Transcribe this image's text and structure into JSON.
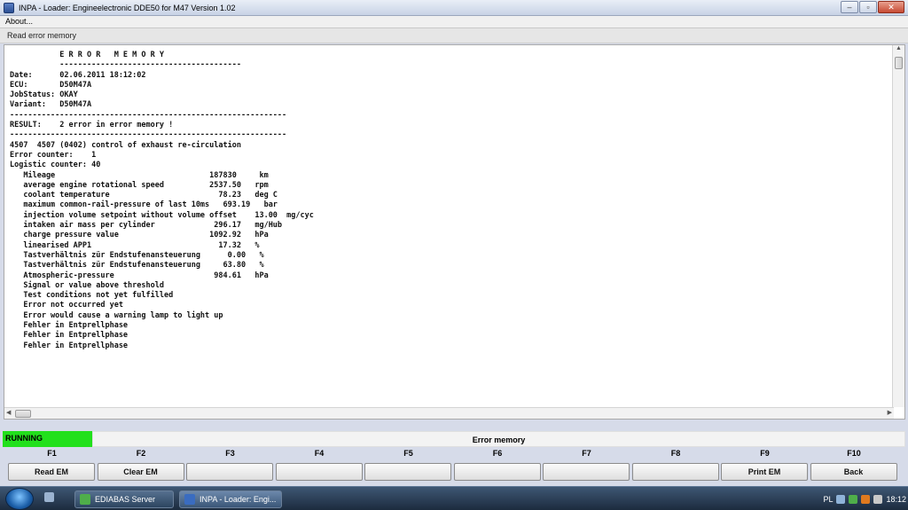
{
  "window": {
    "title": "INPA - Loader:  Engineelectronic DDE50 for M47 Version 1.02",
    "controls": [
      "–",
      "▫",
      "✕"
    ]
  },
  "menu": {
    "items": [
      "About..."
    ]
  },
  "panel": {
    "header": "Read error memory"
  },
  "output": {
    "lines": [
      "           E R R O R   M E M O R Y",
      "           ----------------------------------------",
      "",
      "Date:      02.06.2011 18:12:02",
      "ECU:       D50M47A",
      "JobStatus: OKAY",
      "Variant:   D50M47A",
      "-------------------------------------------------------------",
      "",
      "RESULT:    2 error in error memory !",
      "-------------------------------------------------------------",
      "",
      "4507  4507 (0402) control of exhaust re-circulation",
      "",
      "Error counter:    1",
      "Logistic counter: 40",
      "",
      "   Mileage                                  187830     km",
      "   average engine rotational speed          2537.50   rpm",
      "   coolant temperature                        78.23   deg C",
      "   maximum common-rail-pressure of last 10ms   693.19   bar",
      "   injection volume setpoint without volume offset    13.00  mg/cyc",
      "   intaken air mass per cylinder             296.17   mg/Hub",
      "   charge pressure value                    1092.92   hPa",
      "   linearised APP1                            17.32   %",
      "   Tastverhältnis zür Endstufenansteuerung      0.00   %",
      "   Tastverhältnis zür Endstufenansteuerung     63.80   %",
      "   Atmospheric-pressure                      984.61   hPa",
      "",
      "   Signal or value above threshold",
      "   Test conditions not yet fulfilled",
      "   Error not occurred yet",
      "   Error would cause a warning lamp to light up",
      "   Fehler in Entprellphase",
      "   Fehler in Entprellphase",
      "   Fehler in Entprellphase"
    ]
  },
  "status": {
    "state": "RUNNING",
    "state_color": "#22e01c",
    "label": "Error memory"
  },
  "fkeys": [
    {
      "key": "F1",
      "label": "Read EM"
    },
    {
      "key": "F2",
      "label": "Clear EM"
    },
    {
      "key": "F3",
      "label": ""
    },
    {
      "key": "F4",
      "label": ""
    },
    {
      "key": "F5",
      "label": ""
    },
    {
      "key": "F6",
      "label": ""
    },
    {
      "key": "F7",
      "label": ""
    },
    {
      "key": "F8",
      "label": ""
    },
    {
      "key": "F9",
      "label": "Print EM"
    },
    {
      "key": "F10",
      "label": "Back"
    }
  ],
  "taskbar": {
    "tasks": [
      {
        "label": "EDIABAS Server",
        "icon": "ediabas-icon"
      },
      {
        "label": "INPA - Loader:  Engi...",
        "icon": "inpa-icon"
      }
    ],
    "tray": {
      "language": "PL",
      "time": "18:12"
    }
  }
}
